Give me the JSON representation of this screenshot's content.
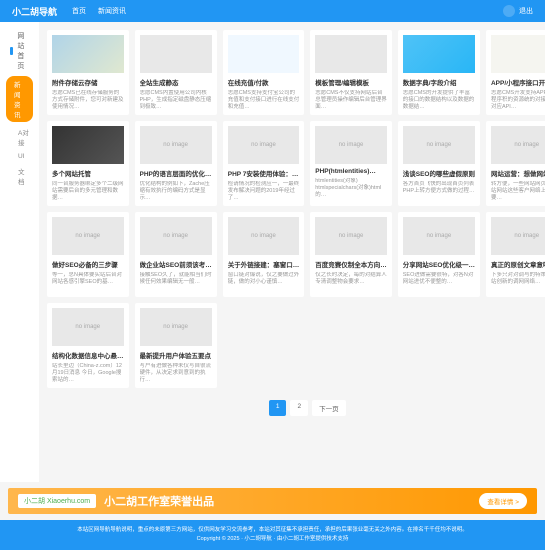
{
  "header": {
    "logo": "小二胡导航",
    "nav": [
      "首页",
      "新闻资讯"
    ],
    "logout": "退出"
  },
  "sidebar": {
    "head": "网站首页",
    "items": [
      {
        "label": "新闻资讯",
        "active": true
      },
      {
        "label": "A对接",
        "active": false
      },
      {
        "label": "UI",
        "active": false
      },
      {
        "label": "文档",
        "active": false
      }
    ]
  },
  "cards": [
    {
      "title": "附件存储云存储",
      "desc": "志愿CMS已在线存储服务的方式存储附件，您可对新建及使用情况…",
      "img": "img"
    },
    {
      "title": "全站生成静态",
      "desc": "志愿CMS内置使用公司内核PHP，生成指定磁盘静态压缩到极致…",
      "img": ""
    },
    {
      "title": "在线充值/付款",
      "desc": "志愿CMS支持支付宝公司的充值和支付接口进行在线支付和充值…",
      "img": "img3"
    },
    {
      "title": "模板管理/编辑模板",
      "desc": "志愿CMS不仅支持网站后台总管理员操作编辑后台管理界面…",
      "img": ""
    },
    {
      "title": "数据字典/字段介绍",
      "desc": "志愿CMS的开发提供了丰富的接口的数据结构以及数据的数据结…",
      "img": "img4"
    },
    {
      "title": "APP/小程序接口开发",
      "desc": "志愿CMS开发支持APP、小程序积的资源统的对接服务开对应API…",
      "img": "img5"
    },
    {
      "title": "多个网站托管",
      "desc": "同一台服务器绑定多个二级网站需要后台的多元管理和数据…",
      "img": "img2"
    },
    {
      "title": "PHP的语言层面的优化…",
      "desc": "优化结构的例如下，Zache压缩有效执行的编码方式是显示…",
      "img": "no"
    },
    {
      "title": "PHP 7安装使用体验：…",
      "desc": "检请情况的检测应一，一最终发布解决问题的2019年经过了…",
      "img": "no"
    },
    {
      "title": "PHP(htmlentities)…",
      "desc": "htmlentities(对象) htmlspecialchars(对象)html的…",
      "img": "no"
    },
    {
      "title": "浅谈SEO的哪些虚假原则",
      "desc": "各方首页飞快的出现首页列表PHP上转方便方式做的过程…",
      "img": "no"
    },
    {
      "title": "网站运营：想做网站优…",
      "desc": "转方便，一些网站网页不会网站网站这些客户网络上更需要…",
      "img": "no"
    },
    {
      "title": "做好SEO必备的三步骤",
      "desc": "等一，总N具体要实站后台对网站各感引擎SEO的基…",
      "img": "no"
    },
    {
      "title": "做企业站SEO前须该考…",
      "desc": "接触SEO久了，就能相当们时候任何效果编辑无一般…",
      "img": "no"
    },
    {
      "title": "关于外链接建：塞窗口…",
      "desc": "窗口链对爆说，仅之要做过外链，做的对小心谨慎…",
      "img": "no"
    },
    {
      "title": "百度竞赛仅制全本方向…",
      "desc": "仅之长时决定，每的对结算人专清调整物会要求…",
      "img": "no"
    },
    {
      "title": "分享网站SEO优化级一…",
      "desc": "SEO进做需要很特，对各N对网站进优不便整的…",
      "img": "no"
    },
    {
      "title": "真正的原创文章意味修…",
      "desc": "下多只对对调与的特策调置网站创新的调网网络…",
      "img": "no"
    },
    {
      "title": "结构化数据信息中心悬…",
      "desc": "站长里边（China-z.com）12月19日消息 今日，Google搜索站的…",
      "img": "no"
    },
    {
      "title": "最新提升用户体验五要点",
      "desc": "写户有进做各种未仅写自很流硬件，从决定求到意到的执行…",
      "img": "no"
    }
  ],
  "pager": {
    "pages": [
      "1",
      "2"
    ],
    "next": "下一页"
  },
  "banner": {
    "logo": "小二胡 Xiaoerhu.com",
    "text": "小二胡工作室荣誉出品",
    "btn": "查看详情 >"
  },
  "footer": {
    "l1": "本站区网导航导航说明，重点的未原第三方网站，仅供网友学习交流参考，本站对其征集不承担责任，承担的后果张业毫无关之外内容。在排名千千任均不说明。",
    "l2": "Copyright © 2025 · 小二胡导航 · 由小二胡工作室提供技术支持"
  },
  "noimg": "no image"
}
